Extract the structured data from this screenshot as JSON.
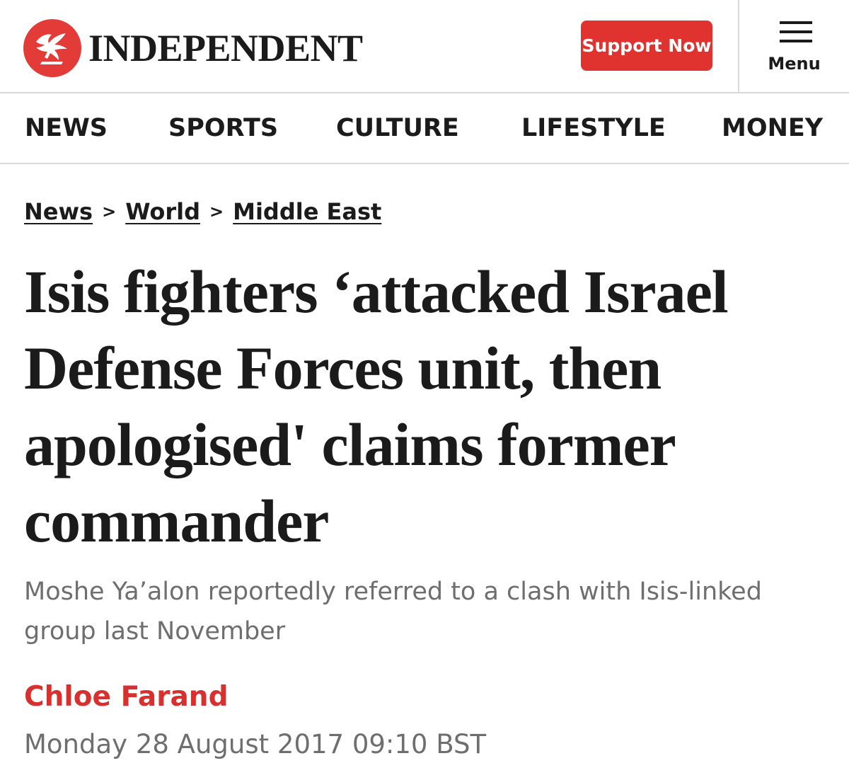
{
  "header": {
    "brand": "INDEPENDENT",
    "logo_icon": "eagle-icon",
    "support_label": "Support Now",
    "menu_label": "Menu",
    "menu_icon": "hamburger-icon",
    "brand_color": "#e33c38"
  },
  "nav": {
    "items": [
      {
        "label": "NEWS"
      },
      {
        "label": "SPORTS"
      },
      {
        "label": "CULTURE"
      },
      {
        "label": "LIFESTYLE"
      },
      {
        "label": "MONEY"
      }
    ]
  },
  "breadcrumb": {
    "items": [
      {
        "label": "News"
      },
      {
        "label": "World"
      },
      {
        "label": "Middle East"
      }
    ],
    "separator": ">"
  },
  "article": {
    "headline": "Isis fighters ‘attacked Israel Defense Forces unit, then apologised' claims former commander",
    "standfirst": "Moshe Ya’alon reportedly referred to a clash with Isis-linked group last November",
    "author": "Chloe Farand",
    "date": "Monday 28 August 2017 09:10 BST",
    "author_color": "#d8302e"
  }
}
